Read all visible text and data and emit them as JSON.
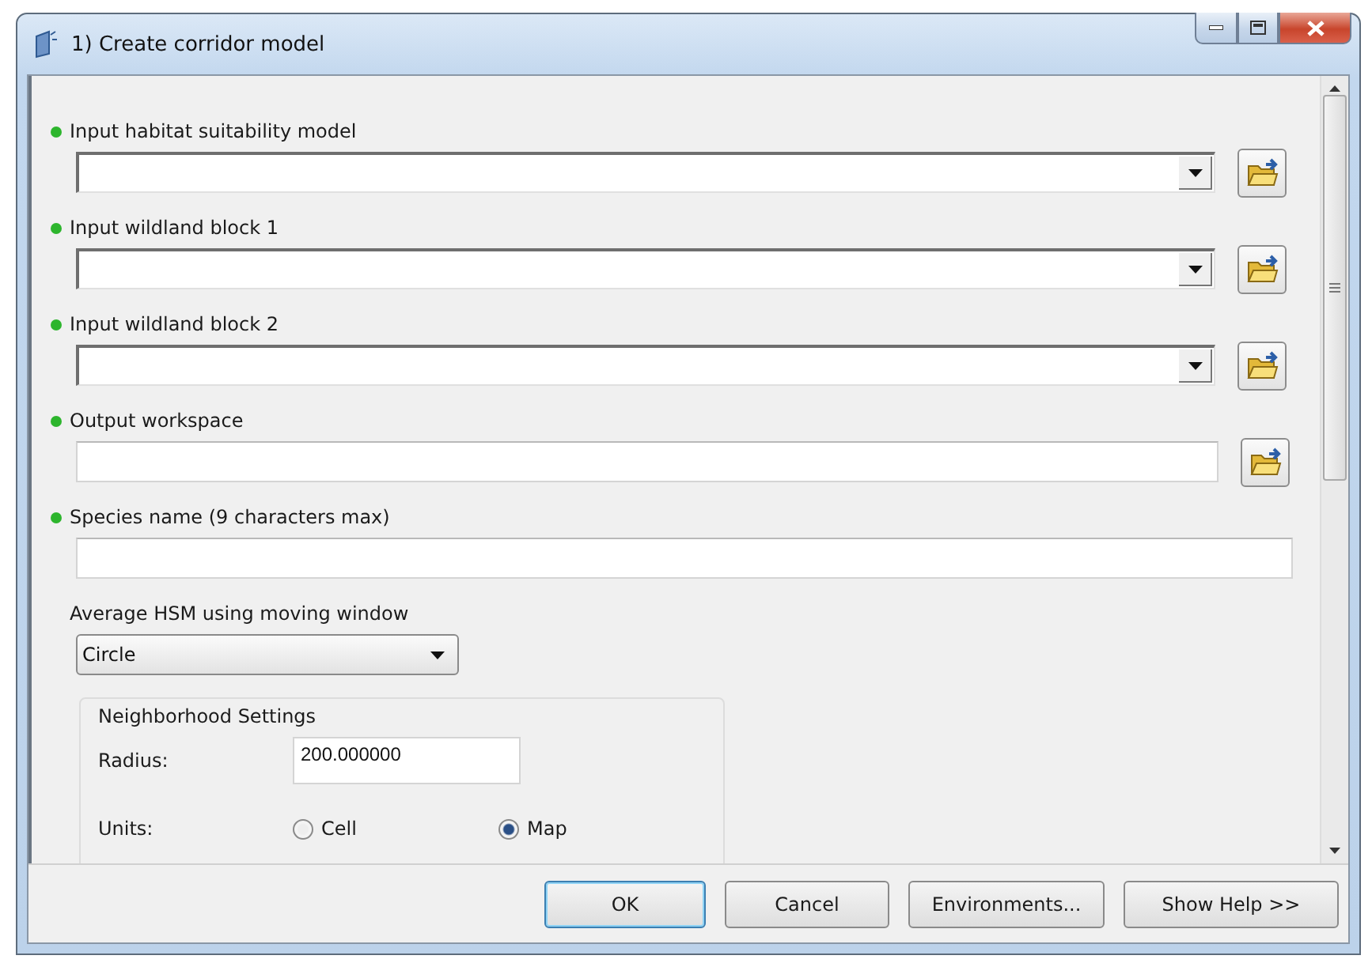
{
  "window": {
    "title": "1) Create corridor model"
  },
  "parameters": [
    {
      "kind": "combo",
      "label": "Input habitat suitability model",
      "required": true
    },
    {
      "kind": "combo",
      "label": "Input wildland block 1",
      "required": true
    },
    {
      "kind": "combo",
      "label": "Input wildland block 2",
      "required": true
    },
    {
      "kind": "browse",
      "label": "Output workspace",
      "required": true
    },
    {
      "kind": "text",
      "label": "Species name (9 characters max)",
      "required": true
    }
  ],
  "moving_window": {
    "label": "Average HSM using moving window",
    "value": "Circle"
  },
  "neighborhood": {
    "title": "Neighborhood Settings",
    "radius_label": "Radius:",
    "radius_value": "200.000000",
    "units_label": "Units:",
    "units": [
      {
        "label": "Cell",
        "selected": false
      },
      {
        "label": "Map",
        "selected": true
      }
    ]
  },
  "buttons": [
    {
      "label": "OK",
      "default": true
    },
    {
      "label": "Cancel",
      "default": false
    },
    {
      "label": "Environments...",
      "default": false
    },
    {
      "label": "Show Help >>",
      "default": false
    }
  ]
}
